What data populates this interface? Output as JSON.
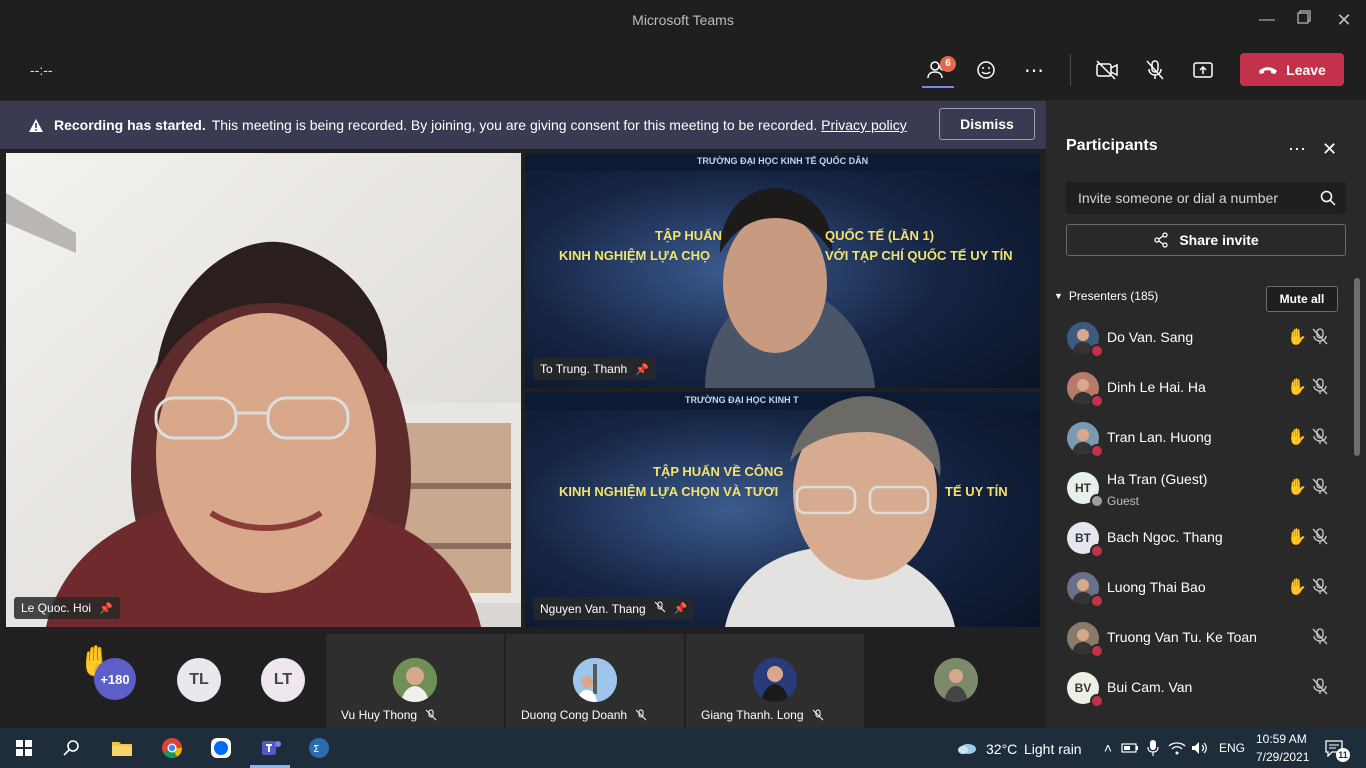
{
  "window": {
    "title": "Microsoft Teams"
  },
  "meeting": {
    "timer": "--:--",
    "participants_badge": "6",
    "leave_label": "Leave"
  },
  "banner": {
    "strong": "Recording has started.",
    "text": "This meeting is being recorded. By joining, you are giving consent for this meeting to be recorded.",
    "link": "Privacy policy",
    "dismiss": "Dismiss"
  },
  "stage": {
    "main_name": "Le Quoc. Hoi",
    "right_top_name": "To Trung. Thanh",
    "right_bottom_name": "Nguyen Van. Thang",
    "slide_top_line": "TRƯỜNG ĐẠI HỌC KINH TẾ QUỐC DÂN",
    "slide_partial_top": "TRƯỜNG ĐẠI HỌC KINH T",
    "slide_line1_a": "TẬP HUẤN",
    "slide_line1_b": "QUỐC TẾ (LẦN 1)",
    "slide_line2_a": "KINH NGHIỆM LỰA CHỌ",
    "slide_line2_b": "VỚI TẠP CHÍ QUỐC TẾ UY TÍN",
    "slide2_line1": "TẬP HUẤN VỀ CÔNG",
    "slide2_line2_a": "KINH NGHIỆM LỰA CHỌN VÀ TƯƠI",
    "slide2_line2_b": "TẾ UY TÍN"
  },
  "strip": {
    "overflow_count": "+180",
    "avatar1": "TL",
    "avatar2": "LT",
    "tiles": [
      {
        "name": "Vu Huy Thong"
      },
      {
        "name": "Duong Cong Doanh"
      },
      {
        "name": "Giang Thanh. Long"
      }
    ]
  },
  "panel": {
    "title": "Participants",
    "invite_placeholder": "Invite someone or dial a number",
    "share_invite": "Share invite",
    "presenters_label": "Presenters (185)",
    "mute_all": "Mute all",
    "people": [
      {
        "name": "Do Van. Sang",
        "initials": "",
        "hand": true,
        "status_color": "#c4314b"
      },
      {
        "name": "Dinh Le Hai. Ha",
        "initials": "",
        "hand": true,
        "status_color": "#c4314b"
      },
      {
        "name": "Tran Lan. Huong",
        "initials": "",
        "hand": true,
        "status_color": "#c4314b"
      },
      {
        "name": "Ha Tran (Guest)",
        "sub": "Guest",
        "initials": "HT",
        "hand": true,
        "status_color": "#9e9e9e"
      },
      {
        "name": "Bach Ngoc. Thang",
        "initials": "BT",
        "hand": true,
        "status_color": "#c4314b"
      },
      {
        "name": "Luong Thai Bao",
        "initials": "",
        "hand": true,
        "status_color": "#c4314b"
      },
      {
        "name": "Truong Van Tu. Ke Toan",
        "initials": "",
        "hand": false,
        "status_color": "#c4314b"
      },
      {
        "name": "Bui Cam. Van",
        "initials": "BV",
        "hand": false,
        "status_color": "#c4314b"
      }
    ]
  },
  "taskbar": {
    "weather_temp": "32°C",
    "weather_text": "Light rain",
    "language": "ENG",
    "time": "10:59 AM",
    "date": "7/29/2021",
    "notifications": "11"
  }
}
